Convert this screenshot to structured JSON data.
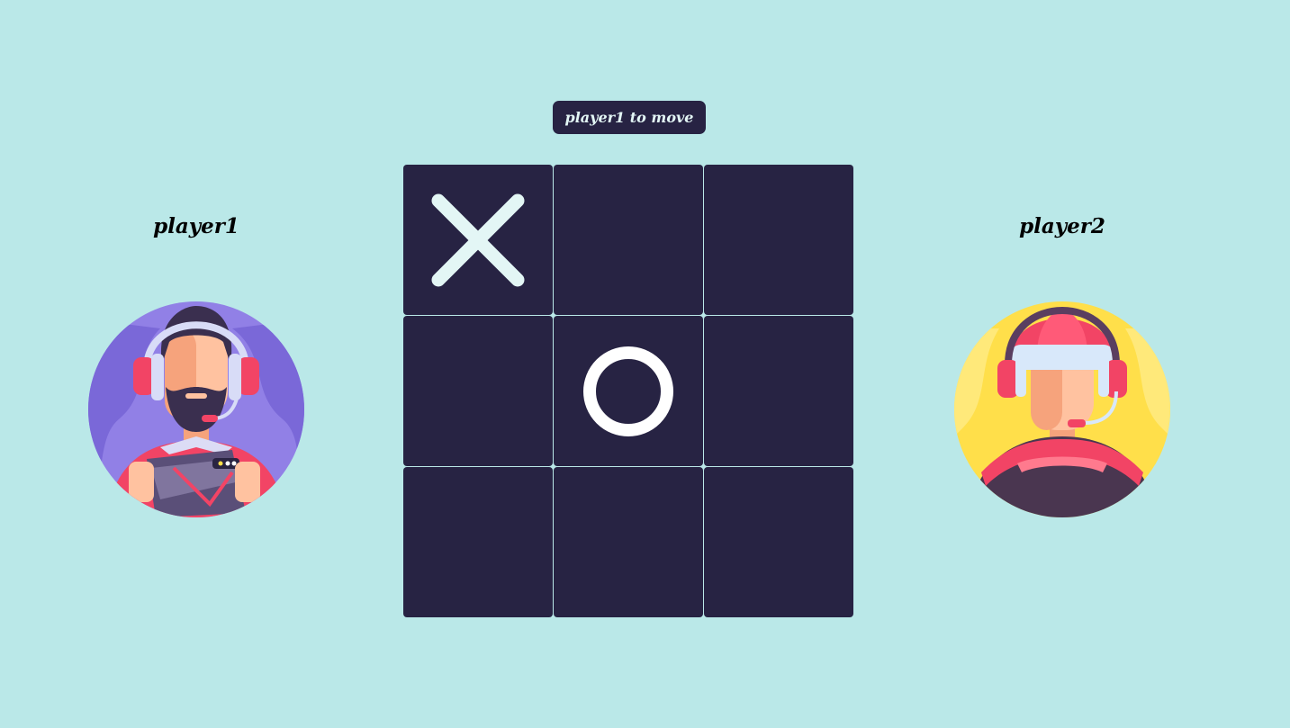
{
  "status": {
    "text": "player1 to move"
  },
  "players": [
    {
      "name": "player1",
      "avatar_icon": "gamer-bearded-headset-avatar-icon",
      "accent": "#9180e6"
    },
    {
      "name": "player2",
      "avatar_icon": "gamer-red-cap-headset-avatar-icon",
      "accent": "#ffdf4a"
    }
  ],
  "board": {
    "cells": [
      [
        "X",
        "",
        ""
      ],
      [
        "",
        "O",
        ""
      ],
      [
        "",
        "",
        ""
      ]
    ]
  },
  "colors": {
    "background": "#bae8e8",
    "cell": "#272343",
    "x_mark": "#e3f6f5",
    "o_mark": "#ffffff"
  }
}
